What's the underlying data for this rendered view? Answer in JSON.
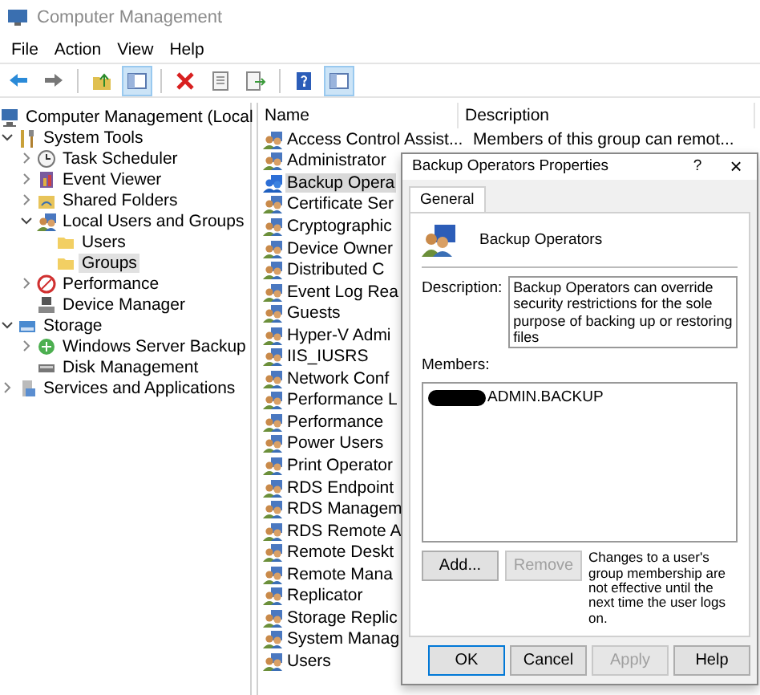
{
  "window": {
    "title": "Computer Management"
  },
  "menu": [
    "File",
    "Action",
    "View",
    "Help"
  ],
  "toolbar": [
    {
      "kind": "back"
    },
    {
      "kind": "forward"
    },
    {
      "kind": "sep"
    },
    {
      "kind": "up"
    },
    {
      "kind": "pane",
      "on": true
    },
    {
      "kind": "sep"
    },
    {
      "kind": "delete"
    },
    {
      "kind": "props"
    },
    {
      "kind": "export"
    },
    {
      "kind": "sep"
    },
    {
      "kind": "help"
    },
    {
      "kind": "pane",
      "on": true
    }
  ],
  "tree": [
    {
      "label": "Computer Management (Local",
      "kind": "computer",
      "selected": false,
      "children": [
        {
          "label": "System Tools",
          "kind": "tools",
          "expanded": true,
          "selected": false,
          "children": [
            {
              "label": "Task Scheduler",
              "kind": "clock",
              "expanded": false,
              "selected": false
            },
            {
              "label": "Event Viewer",
              "kind": "log",
              "expanded": false,
              "selected": false
            },
            {
              "label": "Shared Folders",
              "kind": "share",
              "expanded": false,
              "selected": false
            },
            {
              "label": "Local Users and Groups",
              "kind": "users",
              "expanded": true,
              "selected": false,
              "children": [
                {
                  "label": "Users",
                  "kind": "folder",
                  "selected": false
                },
                {
                  "label": "Groups",
                  "kind": "folder",
                  "selected": true
                }
              ]
            },
            {
              "label": "Performance",
              "kind": "perf",
              "expanded": false,
              "selected": false
            },
            {
              "label": "Device Manager",
              "kind": "device",
              "selected": false
            }
          ]
        },
        {
          "label": "Storage",
          "kind": "storage",
          "expanded": true,
          "selected": false,
          "children": [
            {
              "label": "Windows Server Backup",
              "kind": "backup",
              "expanded": false,
              "selected": false
            },
            {
              "label": "Disk Management",
              "kind": "disk",
              "selected": false
            }
          ]
        },
        {
          "label": "Services and Applications",
          "kind": "services",
          "expanded": false,
          "selected": false
        }
      ]
    }
  ],
  "list": {
    "columns": [
      "Name",
      "Description"
    ],
    "rows": [
      {
        "name": "Access Control Assist...",
        "description": "Members of this group can remot...",
        "selected": false
      },
      {
        "name": "Administrator",
        "selected": false
      },
      {
        "name": "Backup Opera",
        "selected": true
      },
      {
        "name": "Certificate Ser",
        "selected": false
      },
      {
        "name": "Cryptographic",
        "selected": false
      },
      {
        "name": "Device Owner",
        "selected": false
      },
      {
        "name": "Distributed C",
        "selected": false
      },
      {
        "name": "Event Log Rea",
        "selected": false
      },
      {
        "name": "Guests",
        "selected": false
      },
      {
        "name": "Hyper-V Admi",
        "selected": false
      },
      {
        "name": "IIS_IUSRS",
        "selected": false
      },
      {
        "name": "Network Conf",
        "selected": false
      },
      {
        "name": "Performance L",
        "selected": false
      },
      {
        "name": "Performance",
        "selected": false
      },
      {
        "name": "Power Users",
        "selected": false
      },
      {
        "name": "Print Operator",
        "selected": false
      },
      {
        "name": "RDS Endpoint",
        "selected": false
      },
      {
        "name": "RDS Managem",
        "selected": false
      },
      {
        "name": "RDS Remote A",
        "selected": false
      },
      {
        "name": "Remote Deskt",
        "selected": false
      },
      {
        "name": "Remote Mana",
        "selected": false
      },
      {
        "name": "Replicator",
        "selected": false
      },
      {
        "name": "Storage Replic",
        "selected": false
      },
      {
        "name": "System Manag",
        "selected": false
      },
      {
        "name": "Users",
        "selected": false
      }
    ]
  },
  "dialog": {
    "title": "Backup Operators Properties",
    "help": "?",
    "close": "×",
    "tabs": [
      {
        "label": "General",
        "selected": true
      }
    ],
    "group_name": "Backup Operators",
    "description_label": "Description:",
    "description": "Backup Operators can override security restrictions for the sole purpose of backing up or restoring files",
    "members_label": "Members:",
    "members": [
      {
        "name": "ADMIN.BACKUP",
        "redacted": true
      }
    ],
    "member_buttons": [
      {
        "label": "Add...",
        "disabled": false
      },
      {
        "label": "Remove",
        "disabled": true
      }
    ],
    "note": "Changes to a user's group membership are not effective until the next time the user logs on.",
    "buttons": [
      {
        "label": "OK",
        "default": true,
        "disabled": false
      },
      {
        "label": "Cancel",
        "default": false,
        "disabled": false
      },
      {
        "label": "Apply",
        "default": false,
        "disabled": true
      },
      {
        "label": "Help",
        "default": false,
        "disabled": false
      }
    ]
  }
}
